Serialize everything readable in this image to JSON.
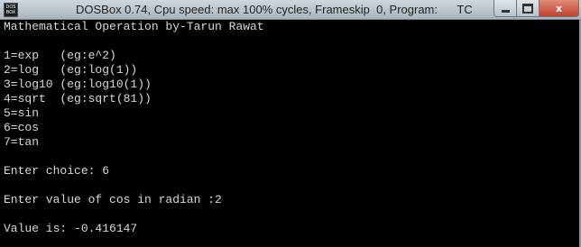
{
  "window": {
    "title": "DOSBox 0.74, Cpu speed: max 100% cycles, Frameskip  0, Program:      TC",
    "icon_label": "DOS BOX",
    "icon": "dosbox-app-icon",
    "controls": {
      "minimize": "minimize-icon",
      "maximize": "maximize-icon",
      "close": "x"
    }
  },
  "console": {
    "lines": [
      "Mathematical Operation by-Tarun Rawat",
      "",
      "1=exp   (eg:e^2)",
      "2=log   (eg:log(1))",
      "3=log10 (eg:log10(1))",
      "4=sqrt  (eg:sqrt(81))",
      "5=sin",
      "6=cos",
      "7=tan",
      "",
      "Enter choice: 6",
      "",
      "Enter value of cos in radian :2",
      "",
      "Value is: -0.416147"
    ]
  },
  "colors": {
    "console_bg": "#000000",
    "console_text": "#d8d8d8",
    "close_button": "#c2402a"
  }
}
